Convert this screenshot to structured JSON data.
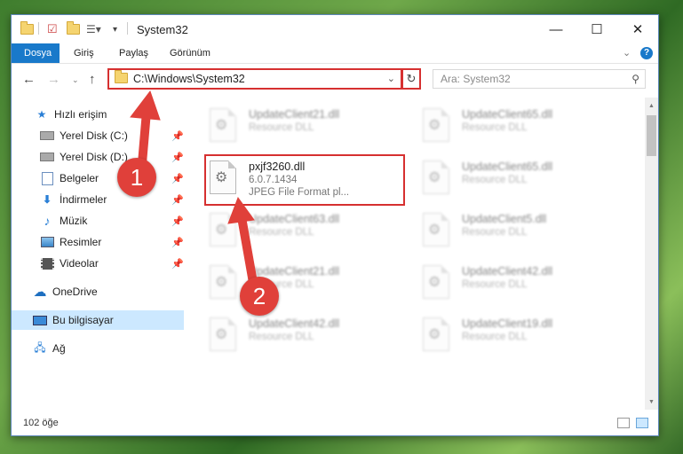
{
  "window": {
    "title": "System32",
    "controls": {
      "minimize": "—",
      "maximize": "☐",
      "close": "✕"
    }
  },
  "ribbon": {
    "tabs": [
      {
        "label": "Dosya",
        "active": true
      },
      {
        "label": "Giriş"
      },
      {
        "label": "Paylaş"
      },
      {
        "label": "Görünüm"
      }
    ],
    "expand_icon": "chevron-down-icon",
    "help_icon": "help-icon"
  },
  "address": {
    "path": "C:\\Windows\\System32",
    "refresh_icon": "refresh-icon"
  },
  "search": {
    "placeholder": "Ara: System32"
  },
  "nav": {
    "items": [
      {
        "label": "Hızlı erişim",
        "icon": "star-icon",
        "pinned": false
      },
      {
        "label": "Yerel Disk (C:)",
        "icon": "drive-icon",
        "pinned": true
      },
      {
        "label": "Yerel Disk (D:)",
        "icon": "drive-icon",
        "pinned": true
      },
      {
        "label": "Belgeler",
        "icon": "documents-icon",
        "pinned": true
      },
      {
        "label": "İndirmeler",
        "icon": "download-icon",
        "pinned": true
      },
      {
        "label": "Müzik",
        "icon": "music-icon",
        "pinned": true
      },
      {
        "label": "Resimler",
        "icon": "pictures-icon",
        "pinned": true
      },
      {
        "label": "Videolar",
        "icon": "video-icon",
        "pinned": true
      },
      {
        "label": "OneDrive",
        "icon": "cloud-icon",
        "pinned": false
      },
      {
        "label": "Bu bilgisayar",
        "icon": "computer-icon",
        "pinned": false,
        "selected": true
      },
      {
        "label": "Ağ",
        "icon": "network-icon",
        "pinned": false
      }
    ]
  },
  "files": [
    {
      "name": "UpdateClient21.dll",
      "line2": "Resource DLL",
      "line3": "",
      "blurred": true
    },
    {
      "name": "UpdateClient65.dll",
      "line2": "Resource DLL",
      "line3": "",
      "blurred": true
    },
    {
      "name": "pxjf3260.dll",
      "line2": "6.0.7.1434",
      "line3": "JPEG File Format pl...",
      "blurred": false
    },
    {
      "name": "UpdateClient65.dll",
      "line2": "Resource DLL",
      "line3": "",
      "blurred": true
    },
    {
      "name": "UpdateClient63.dll",
      "line2": "Resource DLL",
      "line3": "",
      "blurred": true
    },
    {
      "name": "UpdateClient5.dll",
      "line2": "Resource DLL",
      "line3": "",
      "blurred": true
    },
    {
      "name": "UpdateClient21.dll",
      "line2": "Resource DLL",
      "line3": "",
      "blurred": true
    },
    {
      "name": "UpdateClient42.dll",
      "line2": "Resource DLL",
      "line3": "",
      "blurred": true
    },
    {
      "name": "UpdateClient42.dll",
      "line2": "Resource DLL",
      "line3": "",
      "blurred": true
    },
    {
      "name": "UpdateClient19.dll",
      "line2": "Resource DLL",
      "line3": "",
      "blurred": true
    }
  ],
  "status": {
    "count": "102 öğe"
  },
  "callouts": [
    {
      "label": "1"
    },
    {
      "label": "2"
    }
  ],
  "colors": {
    "accent": "#1979ca",
    "highlight": "#d63030",
    "selected": "#cce8ff",
    "callout": "#e0403a"
  }
}
